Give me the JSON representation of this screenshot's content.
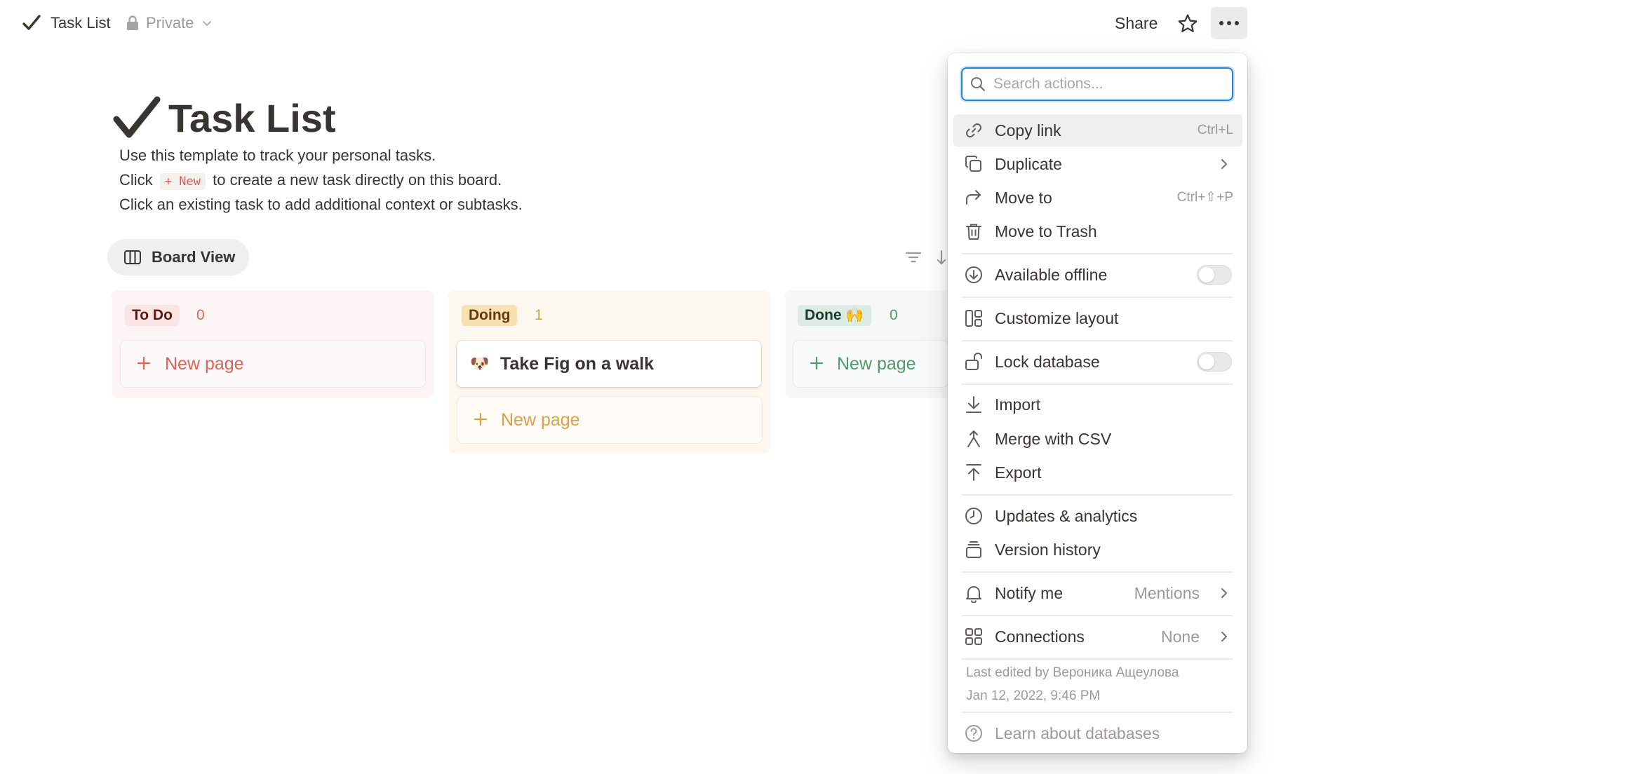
{
  "topbar": {
    "title": "Task List",
    "privacy": "Private",
    "share_label": "Share"
  },
  "page": {
    "title": "Task List",
    "desc_line1": "Use this template to track your personal tasks.",
    "desc_line2_pre": "Click",
    "desc_line2_code": "+ New",
    "desc_line2_post": "to create a new task directly on this board.",
    "desc_line3": "Click an existing task to add additional context or subtasks."
  },
  "view": {
    "tab_label": "Board View"
  },
  "board": {
    "columns": [
      {
        "name": "To Do",
        "count": "0",
        "new_label": "New page"
      },
      {
        "name": "Doing",
        "count": "1",
        "new_label": "New page",
        "cards": [
          {
            "emoji": "🐶",
            "title": "Take Fig on a walk"
          }
        ]
      },
      {
        "name": "Done",
        "emoji": "🙌",
        "count": "0",
        "new_label": "New page"
      }
    ]
  },
  "menu": {
    "search_placeholder": "Search actions...",
    "items": {
      "copy_link": {
        "label": "Copy link",
        "shortcut": "Ctrl+L"
      },
      "duplicate": {
        "label": "Duplicate"
      },
      "move_to": {
        "label": "Move to",
        "shortcut": "Ctrl+⇧+P"
      },
      "move_to_trash": {
        "label": "Move to Trash"
      },
      "available_offline": {
        "label": "Available offline",
        "on": false
      },
      "customize_layout": {
        "label": "Customize layout"
      },
      "lock_database": {
        "label": "Lock database",
        "on": false
      },
      "import": {
        "label": "Import"
      },
      "merge_csv": {
        "label": "Merge with CSV"
      },
      "export": {
        "label": "Export"
      },
      "updates": {
        "label": "Updates & analytics"
      },
      "version_history": {
        "label": "Version history"
      },
      "notify_me": {
        "label": "Notify me",
        "value": "Mentions"
      },
      "connections": {
        "label": "Connections",
        "value": "None"
      },
      "learn": {
        "label": "Learn about databases"
      }
    },
    "footer": {
      "last_edited": "Last edited by Вероника Ащеулова",
      "date": "Jan 12, 2022, 9:46 PM"
    }
  },
  "colors": {
    "accent": "#2383e2",
    "todo_tag_bg": "#fbe4e4",
    "todo_tag_text": "#5d1715",
    "todo_accent": "#e16259",
    "doing_tag_bg": "#f8e1b0",
    "doing_tag_text": "#5f3b0b",
    "doing_accent": "#d9a14b",
    "done_tag_bg": "#dcebe1",
    "done_tag_text": "#1c3829",
    "done_accent": "#4e9a6a"
  }
}
